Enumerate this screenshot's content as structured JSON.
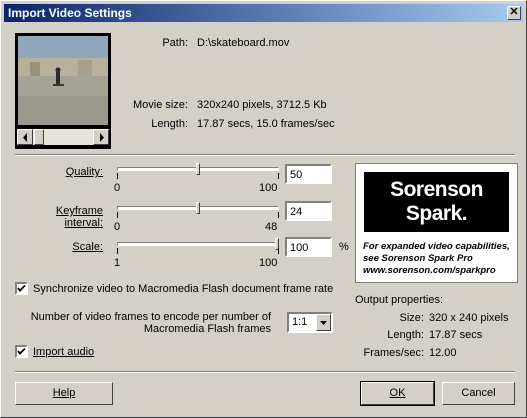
{
  "window": {
    "title": "Import Video Settings",
    "close_glyph": "✕"
  },
  "info": {
    "path_label": "Path:",
    "path_value": "D:\\skateboard.mov",
    "size_label": "Movie size:",
    "size_value": "320x240 pixels, 3712.5 Kb",
    "length_label": "Length:",
    "length_value": "17.87 secs, 15.0 frames/sec"
  },
  "quality": {
    "label": "Quality:",
    "value": "50",
    "min": "0",
    "max": "100",
    "level": 0.5
  },
  "keyframe": {
    "label": "Keyframe interval:",
    "value": "24",
    "min": "0",
    "max": "48",
    "level": 0.5
  },
  "scale": {
    "label": "Scale:",
    "value": "100",
    "min": "1",
    "max": "100",
    "unit": "%",
    "level": 1.0
  },
  "sync": {
    "label": "Synchronize video to Macromedia Flash document frame rate",
    "checked": true
  },
  "frames_ratio": {
    "label_line1": "Number of video frames to encode per number of",
    "label_line2": "Macromedia Flash frames",
    "selected": "1:1"
  },
  "import_audio": {
    "label": "Import audio",
    "checked": true
  },
  "logo": {
    "line1": "Sorenson",
    "line2": "Spark",
    "mark": ".",
    "info1": "For expanded video capabilities,",
    "info2": "see Sorenson Spark Pro",
    "info3": "www.sorenson.com/sparkpro"
  },
  "output": {
    "heading": "Output properties:",
    "size_label": "Size:",
    "size_value": "320 x 240 pixels",
    "length_label": "Length:",
    "length_value": "17.87 secs",
    "fps_label": "Frames/sec:",
    "fps_value": "12.00"
  },
  "buttons": {
    "help": "Help",
    "ok": "OK",
    "cancel": "Cancel"
  },
  "icons": {
    "close": "close-icon",
    "scroll_left": "arrow-left-icon",
    "scroll_right": "arrow-right-icon",
    "dropdown": "chevron-down-icon",
    "check": "checkmark-icon"
  }
}
